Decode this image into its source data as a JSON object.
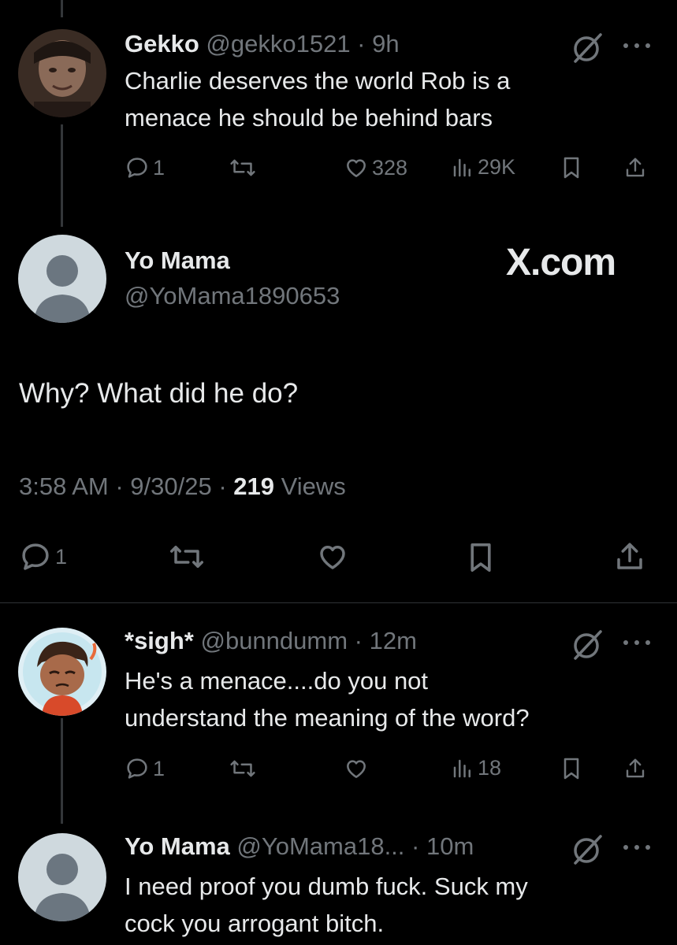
{
  "tweets": [
    {
      "display_name": "Gekko",
      "handle": "@gekko1521",
      "time": "9h",
      "text_lines": [
        "Charlie deserves the world Rob is a",
        "menace he should be behind bars"
      ],
      "replies": "1",
      "likes": "328",
      "views": "29K"
    },
    {
      "display_name": "*sigh*",
      "handle": "@bunndumm",
      "time": "12m",
      "text_lines": [
        "He's a menace....do you not",
        "understand the meaning of the word?"
      ],
      "replies": "1",
      "likes": "",
      "views": "18"
    },
    {
      "display_name": "Yo Mama",
      "handle": "@YoMama18...",
      "time": "10m",
      "text_lines": [
        "I need proof you dumb fuck. Suck my",
        "cock you arrogant bitch."
      ]
    }
  ],
  "main_post": {
    "display_name": "Yo Mama",
    "handle": "@YoMama1890653",
    "text": "Why? What did he do?",
    "timestamp": "3:58 AM · 9/30/25 · ",
    "views_count": "219",
    "views_label": " Views",
    "replies": "1"
  },
  "watermark": "X.com",
  "separator": " · ",
  "colors": {
    "background": "#000000",
    "text": "#e7e9ea",
    "muted": "#71767b",
    "line": "#333639"
  },
  "icons": [
    "reply-icon",
    "retweet-icon",
    "like-icon",
    "views-icon",
    "bookmark-icon",
    "share-icon",
    "slash-icon",
    "more-icon"
  ]
}
